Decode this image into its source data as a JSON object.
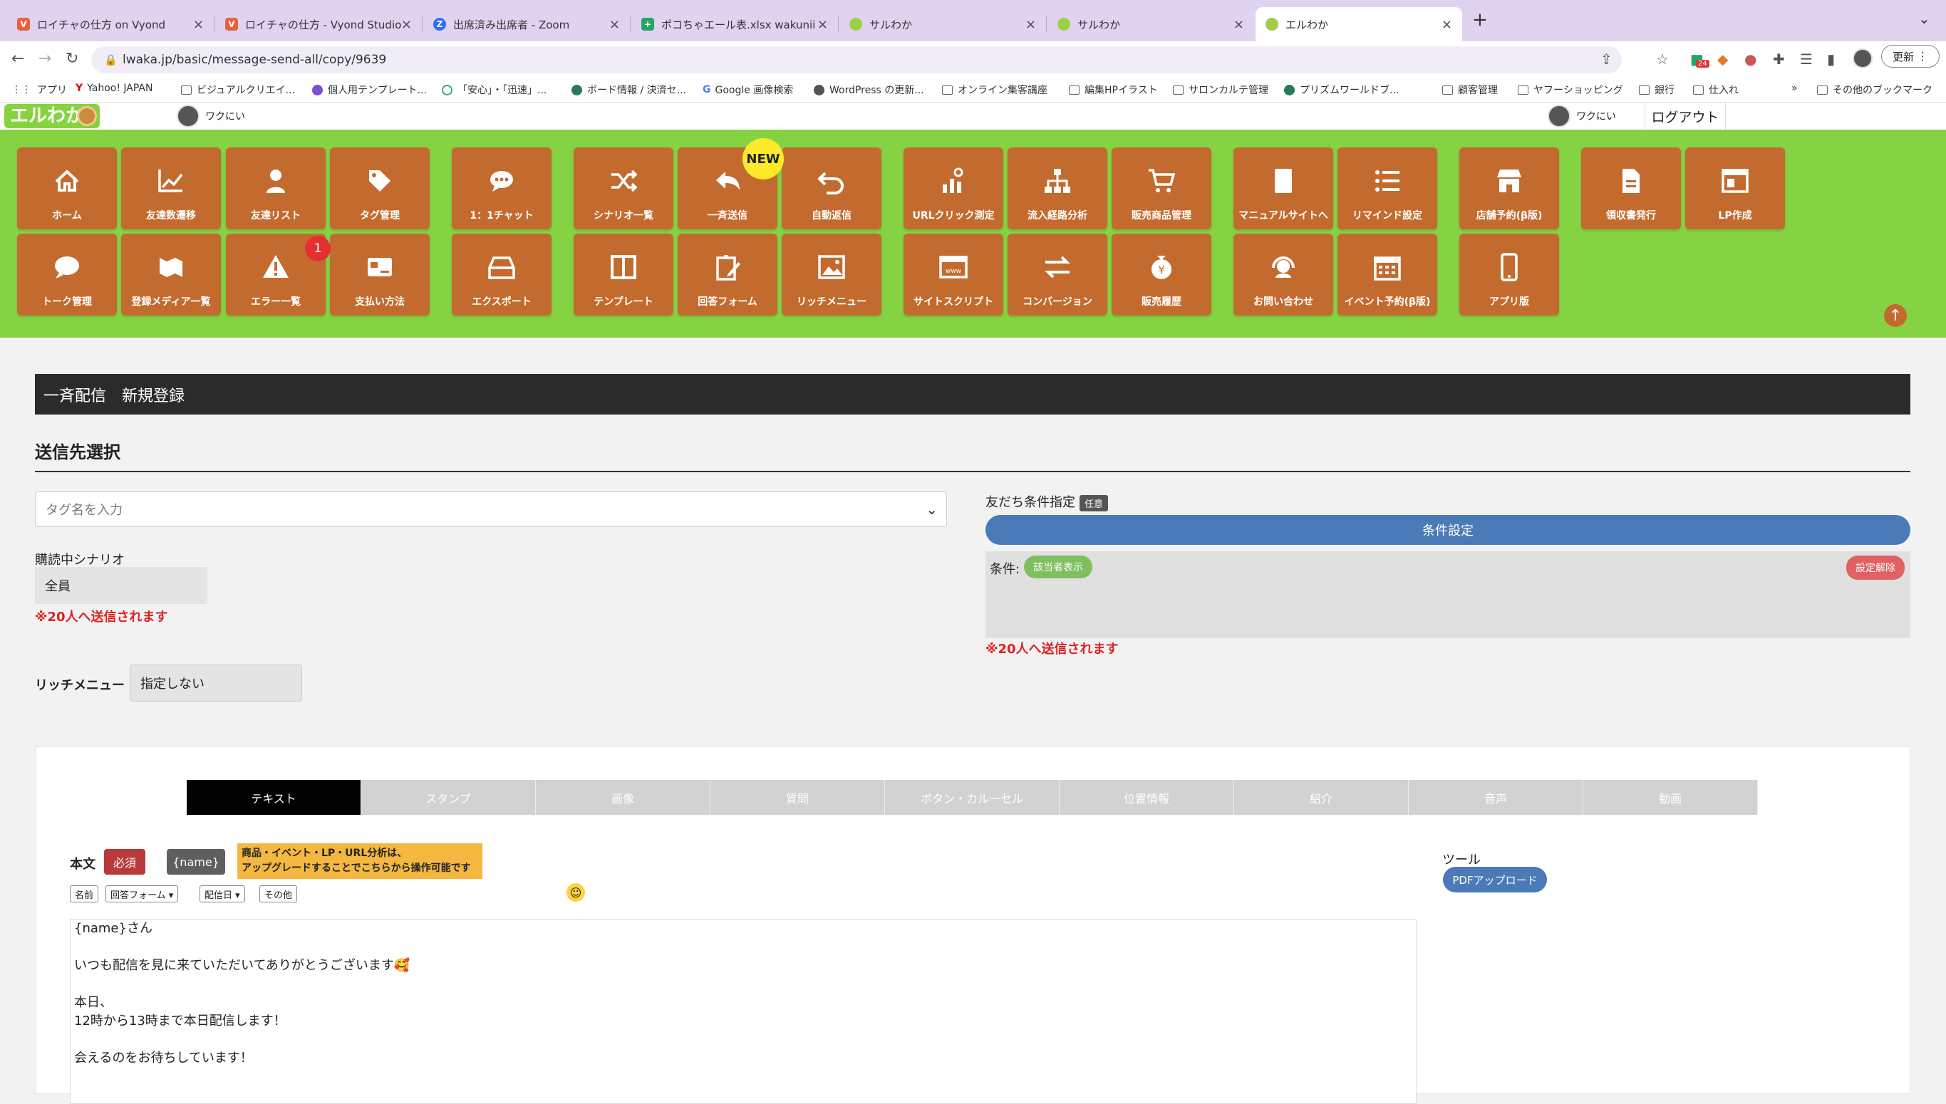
{
  "browser": {
    "tabs": [
      {
        "title": "ロイチャの仕方 on Vyond",
        "icon": "vyond-icon",
        "color": "#e8613a"
      },
      {
        "title": "ロイチャの仕方 - Vyond Studio",
        "icon": "vyond-icon",
        "color": "#e8613a"
      },
      {
        "title": "出席済み出席者 - Zoom",
        "icon": "zoom-icon",
        "color": "#2d6cf5"
      },
      {
        "title": "ポコちゃエール表.xlsx wakunii",
        "icon": "sheets-icon",
        "color": "#23a566"
      },
      {
        "title": "サルわか",
        "icon": "monkey-icon",
        "color": "#9fcf4a"
      },
      {
        "title": "サルわか",
        "icon": "monkey-icon",
        "color": "#9fcf4a"
      },
      {
        "title": "エルわか",
        "icon": "monkey-icon",
        "color": "#9fcf4a"
      }
    ],
    "url": "lwaka.jp/basic/message-send-all/copy/9639",
    "ext_badge": "24",
    "update_label": "更新",
    "bookmarks": [
      "アプリ",
      "Yahoo! JAPAN",
      "ビジュアルクリエイ...",
      "個人用テンプレート...",
      "「安心」・「迅速」...",
      "ボード情報 / 決済セ...",
      "Google 画像検索",
      "WordPress の更新...",
      "オンライン集客講座",
      "編集HPイラスト",
      "サロンカルテ管理",
      "プリズムワールドブ...",
      "顧客管理",
      "ヤフーショッピング",
      "銀行",
      "仕入れ"
    ],
    "bookmarks_more": "»",
    "bookmarks_other": "その他のブックマーク"
  },
  "header": {
    "logo": "エルわか",
    "user_left": "ワクにい",
    "user_right": "ワクにい",
    "logout": "ログアウト"
  },
  "menu": {
    "row1": [
      "ホーム",
      "友達数遷移",
      "友達リスト",
      "タグ管理",
      "1：1チャット",
      "シナリオ一覧",
      "一斉送信",
      "自動返信",
      "URLクリック測定",
      "流入経路分析",
      "販売商品管理",
      "マニュアルサイトへ",
      "リマインド設定",
      "店舗予約(β版)",
      "領収書発行",
      "LP作成"
    ],
    "row2": [
      "トーク管理",
      "登録メディア一覧",
      "エラー一覧",
      "支払い方法",
      "エクスポート",
      "テンプレート",
      "回答フォーム",
      "リッチメニュー",
      "サイトスクリプト",
      "コンバージョン",
      "販売履歴",
      "お問い合わせ",
      "イベント予約(β版)",
      "アプリ版"
    ],
    "new_badge": "NEW",
    "error_count": "1"
  },
  "page": {
    "title": "一斉配信　新規登録",
    "section": "送信先選択",
    "tag_placeholder": "タグ名を入力",
    "scenario_label": "購読中シナリオ",
    "scenario_value": "全員",
    "send_note_left": "※20人へ送信されます",
    "rich_label": "リッチメニュー",
    "rich_value": "指定しない",
    "friend_cond_label": "友だち条件指定",
    "optional": "任意",
    "cond_button": "条件設定",
    "cond_label": "条件:",
    "show_matching": "該当者表示",
    "clear": "設定解除",
    "send_note_right": "※20人へ送信されます"
  },
  "composer": {
    "tabs": [
      "テキスト",
      "スタンプ",
      "画像",
      "質問",
      "ボタン・カルーセル",
      "位置情報",
      "紹介",
      "音声",
      "動画"
    ],
    "body_label": "本文",
    "required": "必須",
    "name_btn": "{name}",
    "upgrade_line1": "商品・イベント・LP・URL分析は、",
    "upgrade_line2": "アップグレードすることでこちらから操作可能です",
    "mini": [
      "名前",
      "回答フォーム ▾",
      "配信日 ▾",
      "その他"
    ],
    "lines": [
      "{name}さん",
      "",
      "いつも配信を見に来ていただいてありがとうございます🥰",
      "",
      "本日、",
      "12時から13時まで本日配信します！",
      "",
      "会えるのをお待ちしています！"
    ],
    "tools_label": "ツール",
    "pdf": "PDFアップロード"
  },
  "colors": {
    "green": "#85d343",
    "tile": "#c36b2e",
    "blue": "#4a7ab8"
  }
}
